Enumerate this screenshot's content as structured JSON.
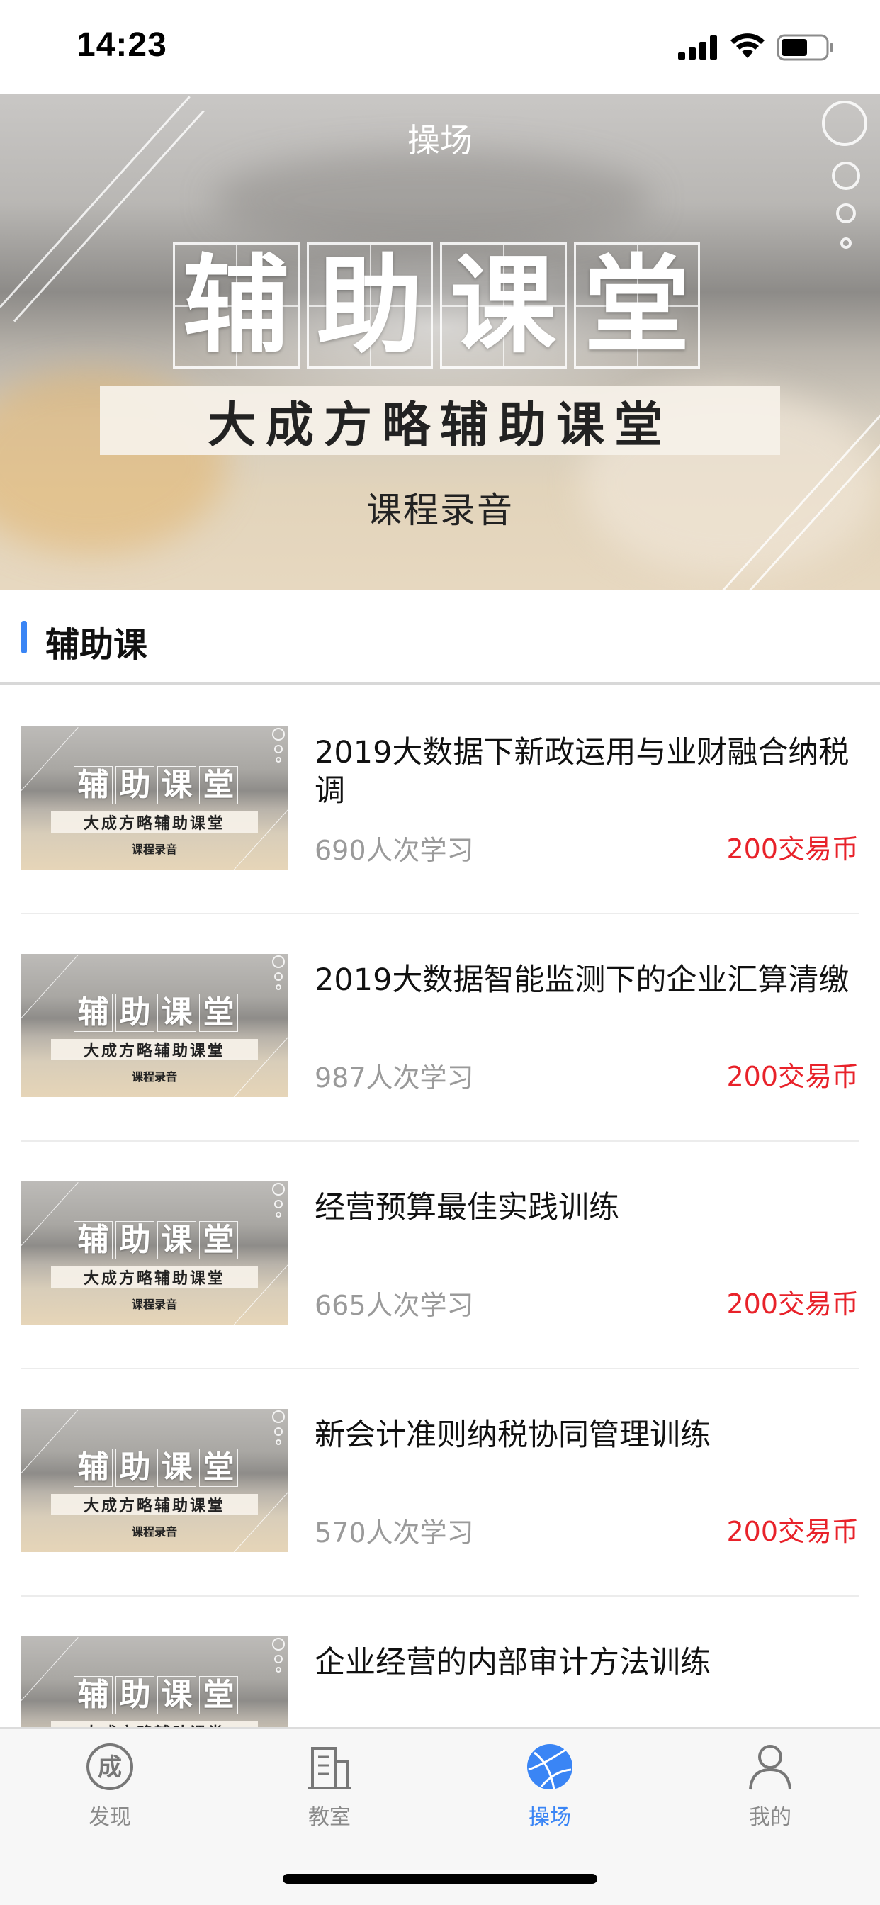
{
  "status_bar": {
    "time": "14:23"
  },
  "banner": {
    "title": "操场",
    "hero_chars": [
      "辅",
      "助",
      "课",
      "堂"
    ],
    "subtitle": "大成方略辅助课堂",
    "caption": "课程录音"
  },
  "section": {
    "title": "辅助课"
  },
  "thumbnail": {
    "chars": [
      "辅",
      "助",
      "课",
      "堂"
    ],
    "subtitle": "大成方略辅助课堂",
    "caption": "课程录音"
  },
  "courses": [
    {
      "title": "2019大数据下新政运用与业财融合纳税调",
      "learners": "690人次学习",
      "price": "200交易币"
    },
    {
      "title": "2019大数据智能监测下的企业汇算清缴",
      "learners": "987人次学习",
      "price": "200交易币"
    },
    {
      "title": "经营预算最佳实践训练",
      "learners": "665人次学习",
      "price": "200交易币"
    },
    {
      "title": "新会计准则纳税协同管理训练",
      "learners": "570人次学习",
      "price": "200交易币"
    },
    {
      "title": "企业经营的内部审计方法训练",
      "learners": "",
      "price": ""
    }
  ],
  "tabs": [
    {
      "label": "发现",
      "icon": "discover-icon"
    },
    {
      "label": "教室",
      "icon": "classroom-icon"
    },
    {
      "label": "操场",
      "icon": "playground-icon",
      "active": true
    },
    {
      "label": "我的",
      "icon": "profile-icon"
    }
  ],
  "colors": {
    "accent": "#3a85f5",
    "price": "#e8222a",
    "muted": "#9a9a9a"
  }
}
